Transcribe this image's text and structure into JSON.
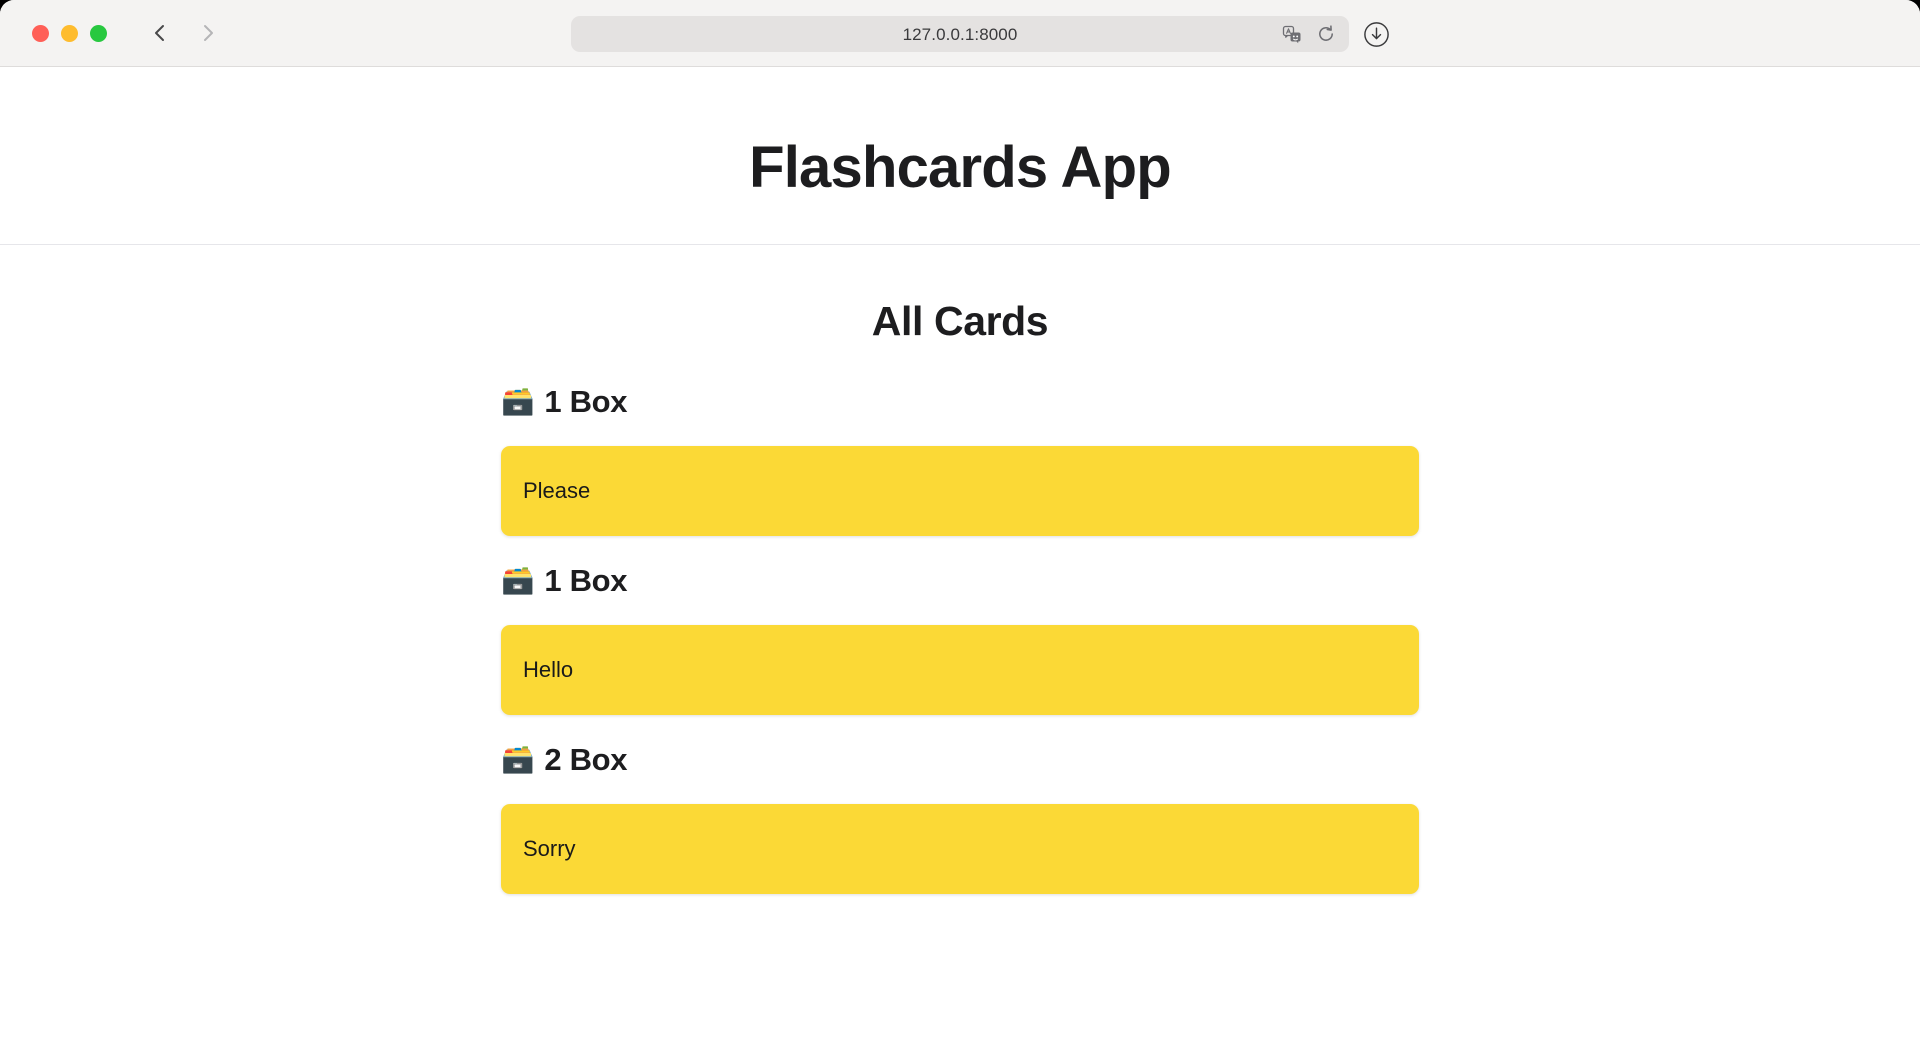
{
  "browser": {
    "url": "127.0.0.1:8000",
    "back_label": "Back",
    "forward_label": "Forward",
    "traffic_lights": [
      "close",
      "minimize",
      "zoom"
    ],
    "toolbar_icons": [
      "translate-icon",
      "reload-icon",
      "download-icon"
    ]
  },
  "header": {
    "app_title": "Flashcards App"
  },
  "main": {
    "heading": "All Cards",
    "box_emoji": "🗃️",
    "groups": [
      {
        "box_label": "1 Box",
        "card_text": "Please"
      },
      {
        "box_label": "1 Box",
        "card_text": "Hello"
      },
      {
        "box_label": "2 Box",
        "card_text": "Sorry"
      }
    ]
  },
  "colors": {
    "card_yellow": "#fbd936",
    "text_dark": "#1d1d1f",
    "toolbar_bg": "#f4f3f2",
    "address_bg": "#e4e2e1",
    "divider": "#e6e6ea"
  }
}
